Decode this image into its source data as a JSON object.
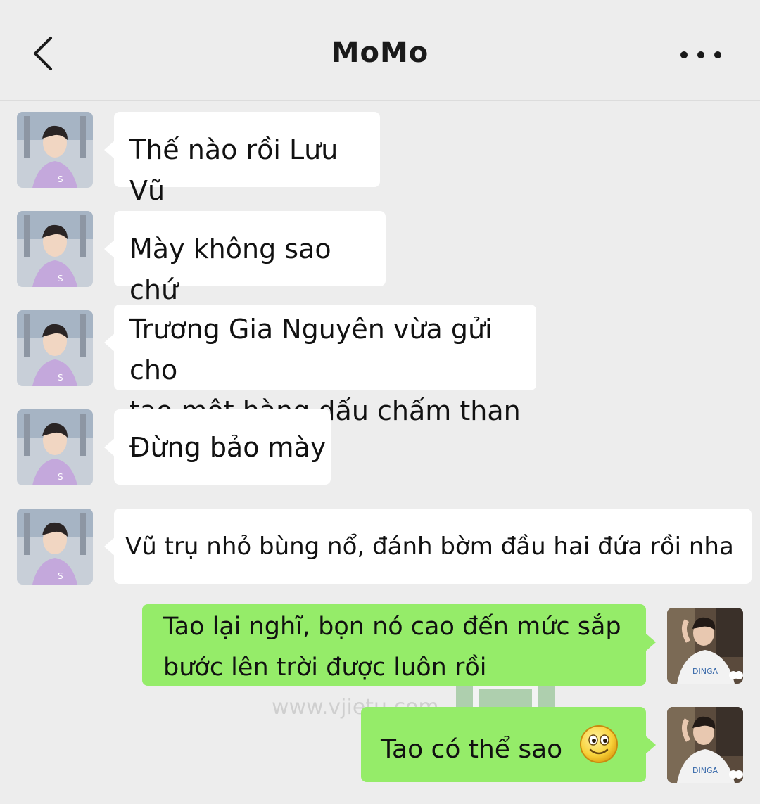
{
  "header": {
    "title": "MoMo",
    "back_icon": "chevron-left-icon",
    "more_icon": "more-dots-icon"
  },
  "colors": {
    "background": "#ededed",
    "incoming_bubble": "#ffffff",
    "outgoing_bubble": "#95ec69"
  },
  "messages": [
    {
      "sender": "MoMo",
      "direction": "incoming",
      "text": "Thế nào rồi Lưu Vũ"
    },
    {
      "sender": "MoMo",
      "direction": "incoming",
      "text": "Mày không sao chứ"
    },
    {
      "sender": "MoMo",
      "direction": "incoming",
      "lines": [
        "Trương Gia Nguyên vừa gửi cho",
        "tao một hàng dấu chấm than"
      ]
    },
    {
      "sender": "MoMo",
      "direction": "incoming",
      "text": "Đừng bảo mày"
    },
    {
      "sender": "MoMo",
      "direction": "incoming",
      "text": "Vũ trụ nhỏ bùng nổ, đánh bờm đầu hai đứa rồi nha"
    },
    {
      "sender": "me",
      "direction": "outgoing",
      "lines": [
        "Tao lại nghĩ, bọn nó cao đến mức sắp",
        "bước lên trời được luôn rồi"
      ]
    },
    {
      "sender": "me",
      "direction": "outgoing",
      "text": "Tao có thể sao",
      "emoji": "smile-emoji-icon"
    }
  ],
  "watermark": {
    "text": "www.vjietu.com"
  }
}
